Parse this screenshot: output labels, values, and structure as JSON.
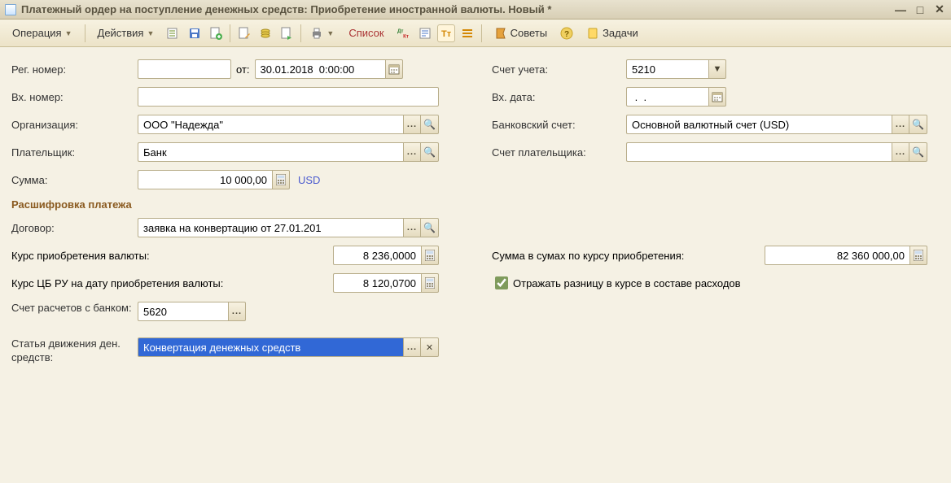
{
  "window": {
    "title": "Платежный ордер на поступление денежных средств: Приобретение иностранной валюты. Новый *"
  },
  "toolbar": {
    "operation": "Операция",
    "actions": "Действия",
    "list": "Список",
    "advice": "Советы",
    "tasks": "Задачи"
  },
  "labels": {
    "reg_number": "Рег. номер:",
    "from": "от:",
    "in_number": "Вх. номер:",
    "organization": "Организация:",
    "payer": "Плательщик:",
    "amount": "Сумма:",
    "account": "Счет учета:",
    "in_date": "Вх. дата:",
    "bank_account": "Банковский счет:",
    "payer_account": "Счет плательщика:",
    "section": "Расшифровка платежа",
    "contract": "Договор:",
    "buy_rate": "Курс приобретения валюты:",
    "cb_rate": "Курс ЦБ РУ на дату приобретения валюты:",
    "sum_in_sums": "Сумма в сумах по курсу приобретения:",
    "reflect_diff": "Отражать разницу в курсе в составе расходов",
    "settlement_account": "Счет расчетов с банком:",
    "cashflow_item": "Статья движения ден. средств:"
  },
  "values": {
    "reg_number": "",
    "date": "30.01.2018  0:00:00",
    "in_number": "",
    "organization": "ООО \"Надежда\"",
    "payer": "Банк",
    "amount": "10 000,00",
    "currency": "USD",
    "account": "5210",
    "in_date": " .  .",
    "bank_account": "Основной валютный счет (USD)",
    "payer_account": "",
    "contract": "заявка на конвертацию от 27.01.201",
    "buy_rate": "8 236,0000",
    "cb_rate": "8 120,0700",
    "sum_in_sums": "82 360 000,00",
    "reflect_diff": true,
    "settlement_account": "5620",
    "cashflow_item": "Конвертация денежных средств"
  }
}
